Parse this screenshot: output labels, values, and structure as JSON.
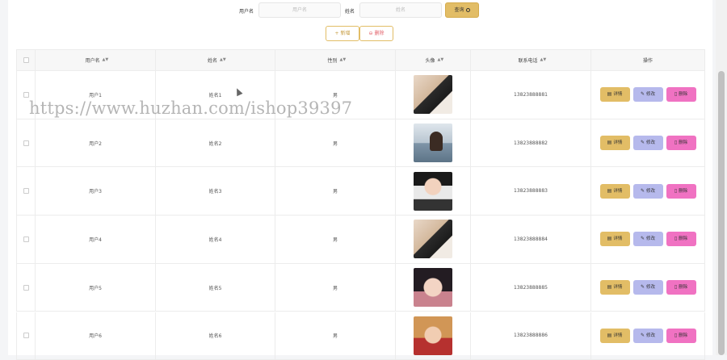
{
  "search": {
    "username_label": "用户名",
    "username_placeholder": "用户名",
    "name_label": "姓名",
    "name_placeholder": "姓名",
    "query_button": "查询"
  },
  "actions": {
    "add": "+ 新增",
    "delete": "⊖ 删除"
  },
  "table": {
    "headers": [
      "用户名",
      "姓名",
      "性别",
      "头像",
      "联系电话",
      "操作"
    ],
    "rows": [
      {
        "username": "用户1",
        "name": "姓名1",
        "gender": "男",
        "phone": "13823888881",
        "avatar": "photo-man-back"
      },
      {
        "username": "用户2",
        "name": "姓名2",
        "gender": "男",
        "phone": "13823888882",
        "avatar": "photo-seaside"
      },
      {
        "username": "用户3",
        "name": "姓名3",
        "gender": "男",
        "phone": "13823888883",
        "avatar": "photo-young-man"
      },
      {
        "username": "用户4",
        "name": "姓名4",
        "gender": "男",
        "phone": "13823888884",
        "avatar": "photo-man-back"
      },
      {
        "username": "用户5",
        "name": "姓名5",
        "gender": "男",
        "phone": "13823888885",
        "avatar": "photo-woman"
      },
      {
        "username": "用户6",
        "name": "姓名6",
        "gender": "男",
        "phone": "13823888886",
        "avatar": "photo-woman-red"
      }
    ],
    "ops": {
      "detail": "详情",
      "edit": "修改",
      "delete": "删除"
    }
  },
  "watermark": "https://www.huzhan.com/ishop39397",
  "colors": {
    "detail": "#e2bd66",
    "edit": "#b6b9ec",
    "delete": "#f072c2",
    "query": "#e2bd66"
  }
}
